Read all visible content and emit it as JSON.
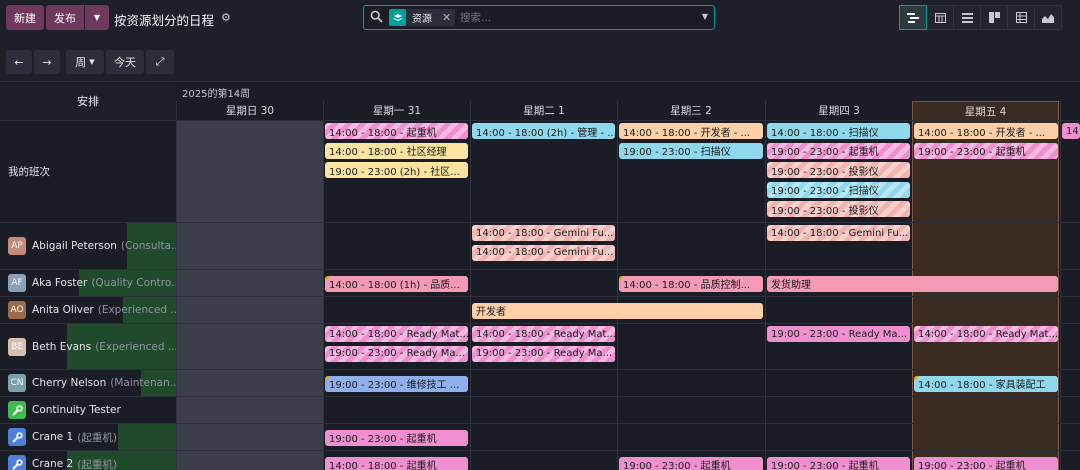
{
  "toolbar": {
    "new_label": "新建",
    "publish_label": "发布",
    "title": "按资源划分的日程",
    "gear_icon": "gear-icon",
    "search": {
      "facet_label": "资源",
      "placeholder": "搜索..."
    },
    "views": [
      "gantt-icon",
      "calendar-icon",
      "list-icon",
      "kanban-icon",
      "pivot-icon",
      "graph-icon"
    ],
    "active_view": "gantt-icon"
  },
  "toolbar2": {
    "prev_icon": "←",
    "next_icon": "→",
    "scale_label": "周",
    "today_label": "今天",
    "expand_icon": "⤢"
  },
  "gantt": {
    "left_header": "安排",
    "week_label": "2025的第14周",
    "days": [
      {
        "label": "星期日 30",
        "today": false
      },
      {
        "label": "星期一 31",
        "today": false
      },
      {
        "label": "星期二 1",
        "today": false
      },
      {
        "label": "星期三 2",
        "today": false
      },
      {
        "label": "星期四 3",
        "today": false
      },
      {
        "label": "星期五 4",
        "today": true
      },
      {
        "label": "",
        "today": false
      }
    ],
    "colors": {
      "pink": "#ef8fcf",
      "cyan": "#8fd8ee",
      "yellow": "#fde3a0",
      "salmon": "#f3b3b0",
      "peach": "#fdd0a8",
      "blue": "#8fb0ec",
      "rose": "#f49ab4",
      "workload": "#1f4a2c",
      "today_bg": "#3a2c22",
      "weekend_bg": "#3b3e4a"
    },
    "rows": [
      {
        "name": "我的班次",
        "role": "",
        "avatar": "",
        "avatar_color": "",
        "workload_pct": 0,
        "shifts": [
          {
            "day": 1,
            "lane": 0,
            "span": 1,
            "text": "14:00 - 18:00 - 起重机",
            "color": "pink",
            "striped": true
          },
          {
            "day": 1,
            "lane": 1,
            "span": 1,
            "text": "14:00 - 18:00 - 社区经理",
            "color": "yellow",
            "striped": false
          },
          {
            "day": 1,
            "lane": 2,
            "span": 1,
            "text": "19:00 - 23:00 (2h) - 社区...",
            "color": "yellow",
            "striped": false
          },
          {
            "day": 2,
            "lane": 0,
            "span": 1,
            "text": "14:00 - 18:00 (2h) - 管理 - ...",
            "color": "cyan",
            "striped": false
          },
          {
            "day": 3,
            "lane": 0,
            "span": 1,
            "text": "14:00 - 18:00 - 开发者 - ...",
            "color": "peach",
            "striped": false
          },
          {
            "day": 3,
            "lane": 1,
            "span": 1,
            "text": "19:00 - 23:00 - 扫描仪",
            "color": "cyan",
            "striped": false
          },
          {
            "day": 4,
            "lane": 0,
            "span": 1,
            "text": "14:00 - 18:00 - 扫描仪",
            "color": "cyan",
            "striped": false
          },
          {
            "day": 4,
            "lane": 1,
            "span": 1,
            "text": "19:00 - 23:00 - 起重机",
            "color": "pink",
            "striped": true
          },
          {
            "day": 4,
            "lane": 2,
            "span": 1,
            "text": "19:00 - 23:00 - 投影仪",
            "color": "salmon",
            "striped": true
          },
          {
            "day": 4,
            "lane": 3,
            "span": 1,
            "text": "19:00 - 23:00 - 扫描仪",
            "color": "cyan",
            "striped": true
          },
          {
            "day": 4,
            "lane": 4,
            "span": 1,
            "text": "19:00 - 23:00 - 投影仪",
            "color": "salmon",
            "striped": true
          },
          {
            "day": 5,
            "lane": 0,
            "span": 1,
            "text": "14:00 - 18:00 - 开发者 - ...",
            "color": "peach",
            "striped": false
          },
          {
            "day": 5,
            "lane": 1,
            "span": 1,
            "text": "19:00 - 23:00 - 起重机",
            "color": "pink",
            "striped": true
          },
          {
            "day": 6,
            "lane": 0,
            "span": 1,
            "text": "14:",
            "color": "pink",
            "striped": false
          }
        ]
      },
      {
        "name": "Abigail Peterson",
        "role": "(Consulta...",
        "avatar": "AP",
        "avatar_color": "#c58a7a",
        "workload_pct": 0.28,
        "shifts": [
          {
            "day": 2,
            "lane": 0,
            "span": 1,
            "text": "14:00 - 18:00 - Gemini Fu...",
            "color": "salmon",
            "striped": true
          },
          {
            "day": 2,
            "lane": 1,
            "span": 1,
            "text": "14:00 - 18:00 - Gemini Fu...",
            "color": "salmon",
            "striped": true
          },
          {
            "day": 4,
            "lane": 0,
            "span": 1,
            "text": "14:00 - 18:00 - Gemini Fu...",
            "color": "salmon",
            "striped": true
          }
        ]
      },
      {
        "name": "Aka Foster",
        "role": "(Quality Contro...",
        "avatar": "AF",
        "avatar_color": "#8aa0b8",
        "workload_pct": 0.55,
        "shifts": [
          {
            "day": 1,
            "lane": 0,
            "span": 1,
            "text": "14:00 - 18:00 (1h) - 品质...",
            "color": "rose",
            "striped": false,
            "flag": true
          },
          {
            "day": 3,
            "lane": 0,
            "span": 1,
            "text": "14:00 - 18:00 - 品质控制...",
            "color": "rose",
            "striped": false,
            "flag": true
          },
          {
            "day": 4,
            "lane": 0,
            "span": 2,
            "text": "发货助理",
            "color": "rose",
            "striped": false
          }
        ]
      },
      {
        "name": "Anita Oliver",
        "role": "(Experienced ...",
        "avatar": "AO",
        "avatar_color": "#9a6a4a",
        "workload_pct": 0.3,
        "shifts": [
          {
            "day": 2,
            "lane": 0,
            "span": 2,
            "text": "开发者",
            "color": "peach",
            "striped": false
          }
        ]
      },
      {
        "name": "Beth Evans",
        "role": "(Experienced ...",
        "avatar": "BE",
        "avatar_color": "#d8c0b0",
        "workload_pct": 0.62,
        "shifts": [
          {
            "day": 1,
            "lane": 0,
            "span": 1,
            "text": "14:00 - 18:00 - Ready Mat...",
            "color": "pink",
            "striped": true
          },
          {
            "day": 1,
            "lane": 1,
            "span": 1,
            "text": "19:00 - 23:00 - Ready Ma...",
            "color": "pink",
            "striped": true
          },
          {
            "day": 2,
            "lane": 0,
            "span": 1,
            "text": "14:00 - 18:00 - Ready Mat...",
            "color": "pink",
            "striped": true
          },
          {
            "day": 2,
            "lane": 1,
            "span": 1,
            "text": "19:00 - 23:00 - Ready Ma...",
            "color": "pink",
            "striped": true
          },
          {
            "day": 4,
            "lane": 0,
            "span": 1,
            "text": "19:00 - 23:00 - Ready Ma...",
            "color": "pink",
            "striped": false
          },
          {
            "day": 5,
            "lane": 0,
            "span": 1,
            "text": "14:00 - 18:00 - Ready Mat...",
            "color": "pink",
            "striped": true
          }
        ]
      },
      {
        "name": "Cherry Nelson",
        "role": "(Maintenan...",
        "avatar": "CN",
        "avatar_color": "#7aa0a8",
        "workload_pct": 0.2,
        "shifts": [
          {
            "day": 1,
            "lane": 0,
            "span": 1,
            "text": "19:00 - 23:00 - 维修技工 ...",
            "color": "blue",
            "striped": false,
            "flag": true
          },
          {
            "day": 5,
            "lane": 0,
            "span": 1,
            "text": "14:00 - 18:00 - 家具装配工",
            "color": "cyan",
            "striped": false,
            "flag": true
          }
        ]
      },
      {
        "name": "Continuity Tester",
        "role": "",
        "avatar": "wrench-icon",
        "avatar_color": "#3fb950",
        "workload_pct": 0,
        "shifts": []
      },
      {
        "name": "Crane 1",
        "role": "(起重机)",
        "avatar": "wrench-icon",
        "avatar_color": "#4f7fd8",
        "workload_pct": 0.33,
        "shifts": [
          {
            "day": 1,
            "lane": 0,
            "span": 1,
            "text": "19:00 - 23:00 - 起重机",
            "color": "pink",
            "striped": false
          }
        ]
      },
      {
        "name": "Crane 2",
        "role": "(起重机)",
        "avatar": "wrench-icon",
        "avatar_color": "#4f7fd8",
        "workload_pct": 0.62,
        "shifts": [
          {
            "day": 1,
            "lane": 0,
            "span": 1,
            "text": "14:00 - 18:00 - 起重机",
            "color": "pink",
            "striped": false
          },
          {
            "day": 3,
            "lane": 0,
            "span": 1,
            "text": "19:00 - 23:00 - 起重机",
            "color": "pink",
            "striped": false
          },
          {
            "day": 4,
            "lane": 0,
            "span": 1,
            "text": "19:00 - 23:00 - 起重机",
            "color": "pink",
            "striped": false
          },
          {
            "day": 5,
            "lane": 0,
            "span": 1,
            "text": "19:00 - 23:00 - 起重机",
            "color": "pink",
            "striped": false
          }
        ]
      }
    ]
  }
}
